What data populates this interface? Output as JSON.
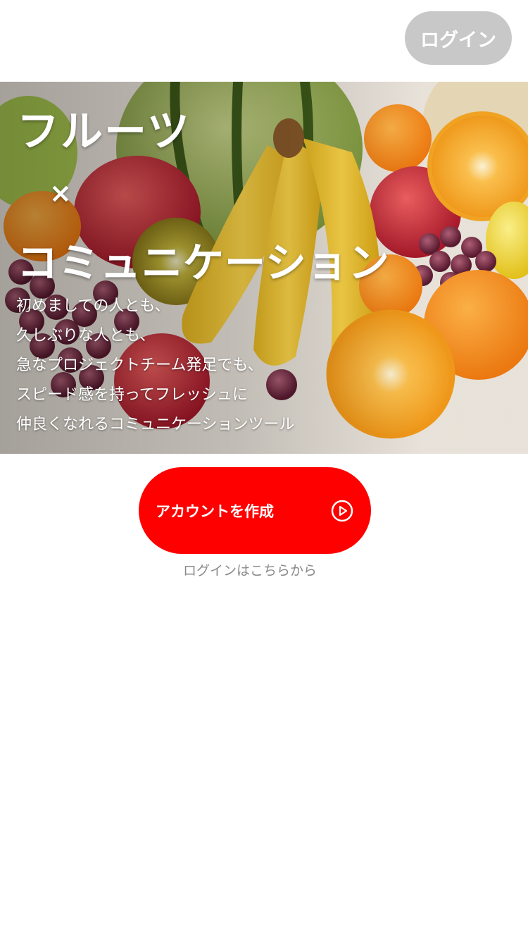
{
  "header": {
    "login_button_label": "ログイン"
  },
  "hero": {
    "title_line_1": "フルーツ",
    "title_separator": "×",
    "title_line_2": "コミュニケーション",
    "tagline": [
      "初めましての人とも、",
      "久しぶりな人とも、",
      "急なプロジェクトチーム発足でも、",
      "スピード感を持ってフレッシュに",
      "仲良くなれるコミュニケーションツール"
    ],
    "background_image": "fruits-photo"
  },
  "cta": {
    "create_account_label": "アカウントを作成",
    "icon": "play-circle-icon",
    "color": "#ff0000"
  },
  "login_link": {
    "label": "ログインはこちらから"
  },
  "colors": {
    "login_button_bg": "#c8c8c8",
    "link_text": "#8a8a8a"
  }
}
